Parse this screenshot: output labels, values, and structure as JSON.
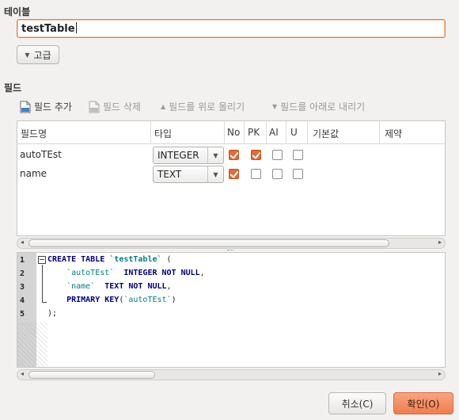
{
  "table_section": {
    "title": "테이블",
    "name_value": "testTable"
  },
  "advanced_button": {
    "label": "고급",
    "icon": "triangle-down-icon"
  },
  "fields_section": {
    "title": "필드",
    "toolbar": {
      "add": "필드 추가",
      "delete": "필드 삭제",
      "move_up": "필드를 위로 올리기",
      "move_down": "필드를 아래로 내리기"
    }
  },
  "grid": {
    "columns": [
      "필드명",
      "타입",
      "No",
      "PK",
      "AI",
      "U",
      "기본값",
      "제약"
    ],
    "rows": [
      {
        "name": "autoTEst",
        "type": "INTEGER",
        "notnull": true,
        "pk": true,
        "ai": false,
        "unique": false,
        "default": "",
        "constraint": ""
      },
      {
        "name": "name",
        "type": "TEXT",
        "notnull": true,
        "pk": false,
        "ai": false,
        "unique": false,
        "default": "",
        "constraint": ""
      }
    ]
  },
  "sql_preview": {
    "line_numbers": [
      "1",
      "2",
      "3",
      "4",
      "5"
    ],
    "lines": [
      [
        {
          "t": "CREATE TABLE ",
          "c": "kw"
        },
        {
          "t": "`testTable`",
          "c": "tn"
        },
        {
          "t": " (",
          "c": ""
        }
      ],
      [
        {
          "t": "    `autoTEst`",
          "c": "id"
        },
        {
          "t": "  ",
          "c": ""
        },
        {
          "t": "INTEGER NOT NULL",
          "c": "kw"
        },
        {
          "t": ",",
          "c": ""
        }
      ],
      [
        {
          "t": "    `name`",
          "c": "id"
        },
        {
          "t": "  ",
          "c": ""
        },
        {
          "t": "TEXT",
          "c": "tp"
        },
        {
          "t": " ",
          "c": ""
        },
        {
          "t": "NOT NULL",
          "c": "kw"
        },
        {
          "t": ",",
          "c": ""
        }
      ],
      [
        {
          "t": "    PRIMARY KEY",
          "c": "kw"
        },
        {
          "t": "(",
          "c": ""
        },
        {
          "t": "`autoTEst`",
          "c": "id"
        },
        {
          "t": ")",
          "c": ""
        }
      ],
      [
        {
          "t": ");",
          "c": ""
        }
      ]
    ]
  },
  "dialog_buttons": {
    "cancel": "취소(C)",
    "ok": "확인(O)"
  },
  "colors": {
    "accent": "#e86a35",
    "focus_border": "#e8823c",
    "ok_button": "#ef7d4f"
  }
}
